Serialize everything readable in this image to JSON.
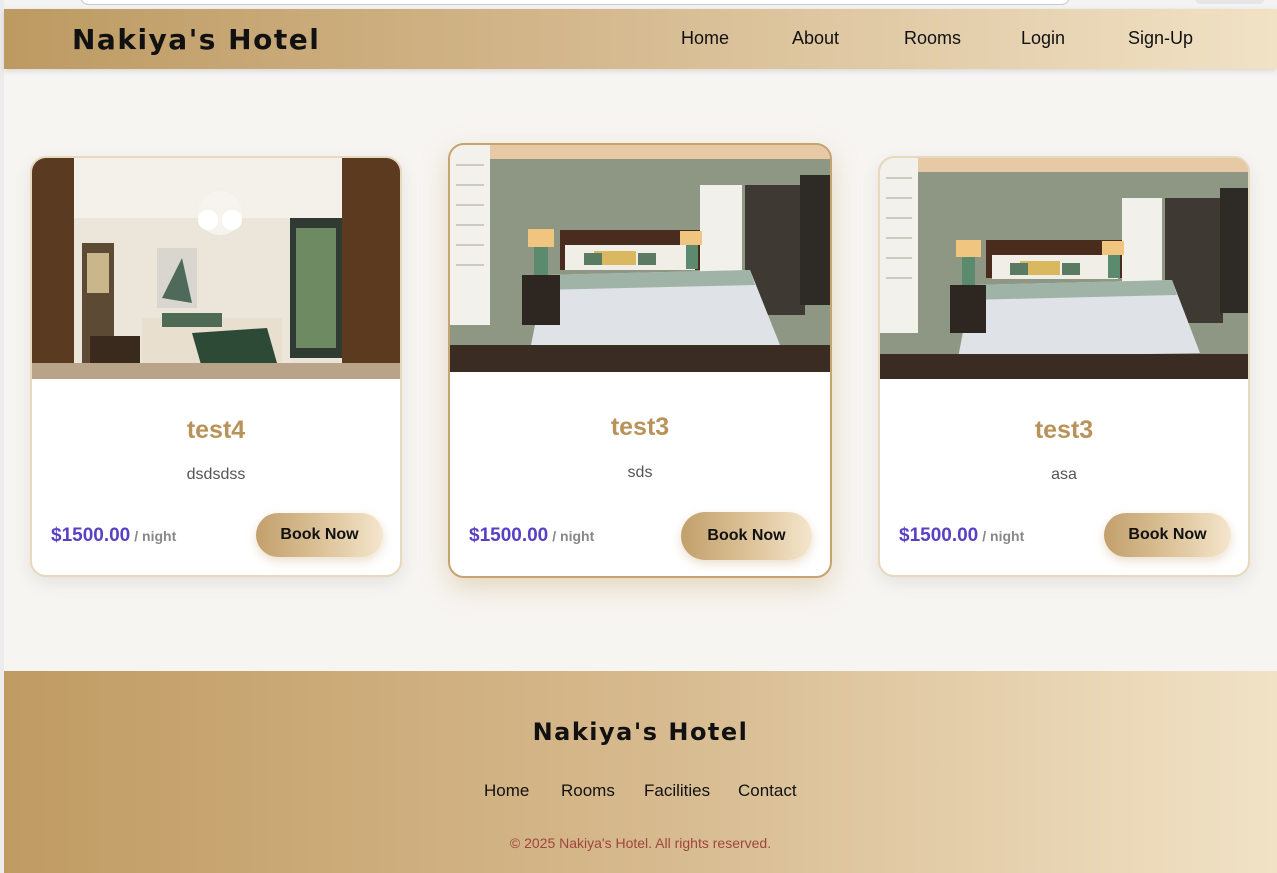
{
  "header": {
    "brand": "Nakiya's Hotel",
    "nav": [
      {
        "label": "Home"
      },
      {
        "label": "About"
      },
      {
        "label": "Rooms"
      },
      {
        "label": "Login"
      },
      {
        "label": "Sign-Up"
      }
    ]
  },
  "rooms": [
    {
      "name": "test4",
      "description": "dsdsdss",
      "price": "$1500.00",
      "per": "/ night",
      "button": "Book Now"
    },
    {
      "name": "test3",
      "description": "sds",
      "price": "$1500.00",
      "per": "/ night",
      "button": "Book Now"
    },
    {
      "name": "test3",
      "description": "asa",
      "price": "$1500.00",
      "per": "/ night",
      "button": "Book Now"
    }
  ],
  "footer": {
    "title": "Nakiya's Hotel",
    "links": [
      {
        "label": "Home"
      },
      {
        "label": "Rooms"
      },
      {
        "label": "Facilities"
      },
      {
        "label": "Contact"
      }
    ],
    "copyright": "© 2025 Nakiya's Hotel. All rights reserved."
  },
  "colors": {
    "accent": "#b89258",
    "price": "#5b3fc4",
    "copyright": "#a0453e"
  }
}
